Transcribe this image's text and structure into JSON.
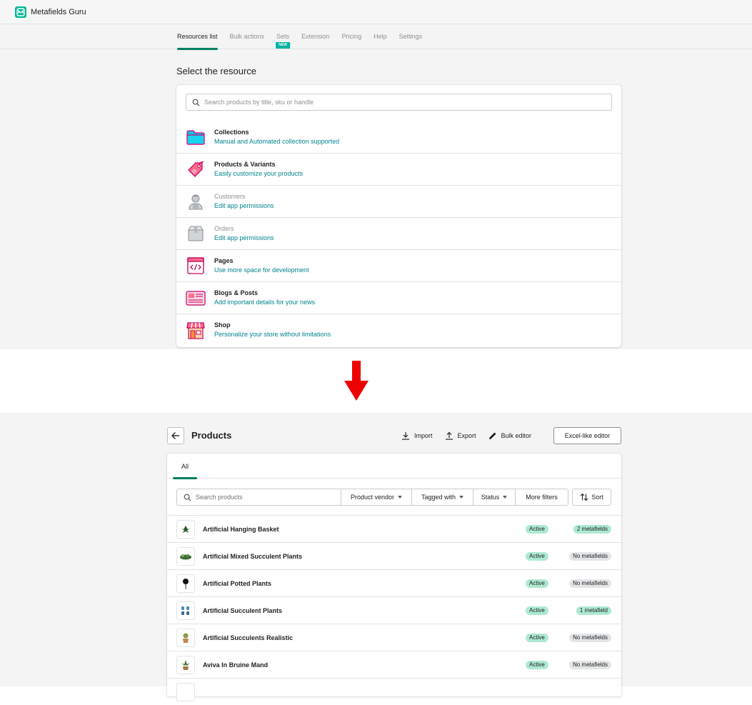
{
  "app": {
    "title": "Metafields Guru",
    "accent": "#008060"
  },
  "nav": {
    "items": [
      {
        "label": "Resources list",
        "active": true
      },
      {
        "label": "Bulk actions"
      },
      {
        "label": "Sets",
        "badge": "NEW"
      },
      {
        "label": "Extension"
      },
      {
        "label": "Pricing"
      },
      {
        "label": "Help"
      },
      {
        "label": "Settings"
      }
    ]
  },
  "resources": {
    "heading": "Select the resource",
    "search_placeholder": "Search products by title, sku or handle",
    "items": [
      {
        "title": "Collections",
        "subtitle": "Manual and Automated collection supported",
        "icon": "folder-icon",
        "disabled": false
      },
      {
        "title": "Products & Variants",
        "subtitle": "Easily customize your products",
        "icon": "price-tag-icon",
        "disabled": false
      },
      {
        "title": "Customers",
        "subtitle": "Edit app permissions",
        "icon": "customer-icon",
        "disabled": true
      },
      {
        "title": "Orders",
        "subtitle": "Edit app permissions",
        "icon": "box-icon",
        "disabled": true
      },
      {
        "title": "Pages",
        "subtitle": "Use more space for development",
        "icon": "code-page-icon",
        "disabled": false
      },
      {
        "title": "Blogs & Posts",
        "subtitle": "Add important details for your news",
        "icon": "newspaper-icon",
        "disabled": false
      },
      {
        "title": "Shop",
        "subtitle": "Personalize your store without limitations",
        "icon": "storefront-icon",
        "disabled": false
      }
    ]
  },
  "products": {
    "title": "Products",
    "toolbar": {
      "import": "Import",
      "export": "Export",
      "bulk": "Bulk editor",
      "excel": "Excel-like editor"
    },
    "tab": "All",
    "search_placeholder": "Search products",
    "filters": [
      "Product vendor",
      "Tagged with",
      "Status",
      "More filters"
    ],
    "sort": "Sort",
    "rows": [
      {
        "name": "Artificial Hanging Basket",
        "status": "Active",
        "metafields": "2 metafields",
        "has": true
      },
      {
        "name": "Artificial Mixed Succulent Plants",
        "status": "Active",
        "metafields": "No metafields",
        "has": false
      },
      {
        "name": "Artificial Potted Plants",
        "status": "Active",
        "metafields": "No metafields",
        "has": false
      },
      {
        "name": "Artificial Succulent Plants",
        "status": "Active",
        "metafields": "1 metafield",
        "has": true
      },
      {
        "name": "Artificial Succulents Realistic",
        "status": "Active",
        "metafields": "No metafields",
        "has": false
      },
      {
        "name": "Aviva In Bruine Mand",
        "status": "Active",
        "metafields": "No metafields",
        "has": false
      },
      {
        "name": "",
        "status": "",
        "metafields": "",
        "has": false
      }
    ]
  }
}
